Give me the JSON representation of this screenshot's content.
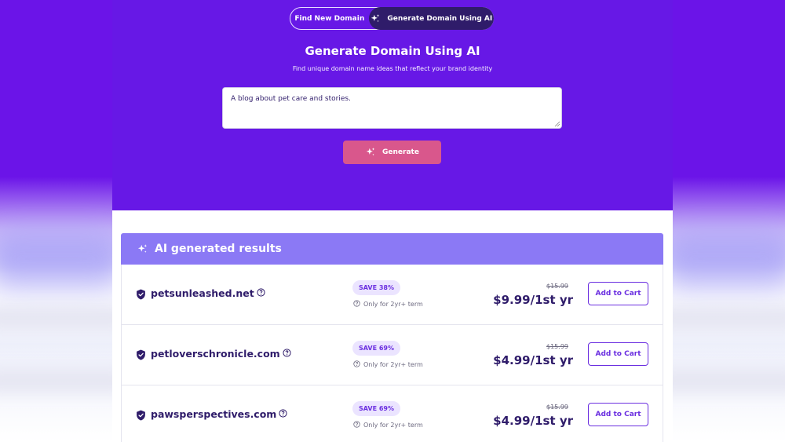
{
  "tabs": {
    "find_new_domain": "Find New Domain",
    "generate_ai": "Generate Domain Using AI",
    "active": "generate_ai"
  },
  "hero": {
    "title": "Generate Domain Using AI",
    "subtitle": "Find unique domain name ideas that reflect your brand identity",
    "prompt_value": "A blog about pet care and stories.",
    "generate_label": "Generate"
  },
  "results": {
    "header": "AI generated results",
    "rows": [
      {
        "domain": "petsunleashed.net",
        "badge": "SAVE 38%",
        "term": "Only for 2yr+ term",
        "old_price": "$15.99",
        "price": "$9.99/1st yr",
        "cart_label": "Add to Cart"
      },
      {
        "domain": "petloverschronicle.com",
        "badge": "SAVE 69%",
        "term": "Only for 2yr+ term",
        "old_price": "$15.99",
        "price": "$4.99/1st yr",
        "cart_label": "Add to Cart"
      },
      {
        "domain": "pawsperspectives.com",
        "badge": "SAVE 69%",
        "term": "Only for 2yr+ term",
        "old_price": "$15.99",
        "price": "$4.99/1st yr",
        "cart_label": "Add to Cart"
      }
    ]
  },
  "icons": {
    "sparkle": "sparkle-icon",
    "shield": "shield-check-icon",
    "help": "help-circle-icon"
  },
  "colors": {
    "hero_bg": "#6718e6",
    "header_bg": "#8b79f5",
    "generate_btn": "#d9578c",
    "brand_dark": "#2f1c6a",
    "accent": "#6b2fe0",
    "badge_bg": "#ebe4ff"
  }
}
